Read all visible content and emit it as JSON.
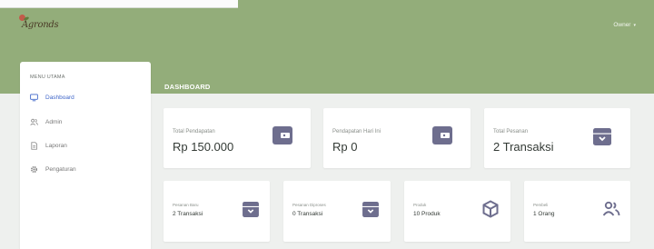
{
  "header": {
    "logo_text": "Agronds",
    "user_label": "Owner"
  },
  "sidebar": {
    "heading": "MENU UTAMA",
    "items": [
      {
        "label": "Dashboard",
        "icon": "monitor-icon",
        "active": true
      },
      {
        "label": "Admin",
        "icon": "users-icon",
        "active": false
      },
      {
        "label": "Laporan",
        "icon": "report-icon",
        "active": false
      },
      {
        "label": "Pengaturan",
        "icon": "gear-icon",
        "active": false
      }
    ]
  },
  "page": {
    "title": "DASHBOARD"
  },
  "stats_top": [
    {
      "label": "Total Pendapatan",
      "value": "Rp 150.000",
      "icon": "wallet-icon"
    },
    {
      "label": "Pendapatan Hari Ini",
      "value": "Rp 0",
      "icon": "wallet-icon"
    },
    {
      "label": "Total Pesanan",
      "value": "2 Transaksi",
      "icon": "archive-icon"
    }
  ],
  "stats_bottom": [
    {
      "label": "Pesanan Baru",
      "value": "2 Transaksi",
      "icon": "archive-icon"
    },
    {
      "label": "Pesanan Diproses",
      "value": "0 Transaksi",
      "icon": "archive-icon"
    },
    {
      "label": "Produk",
      "value": "10 Produk",
      "icon": "box-icon"
    },
    {
      "label": "Pembeli",
      "value": "1 Orang",
      "icon": "user-group-icon"
    }
  ],
  "colors": {
    "header_green": "#93ad7a",
    "icon_purple": "#6e6e8e",
    "active_blue": "#3f66c9"
  }
}
